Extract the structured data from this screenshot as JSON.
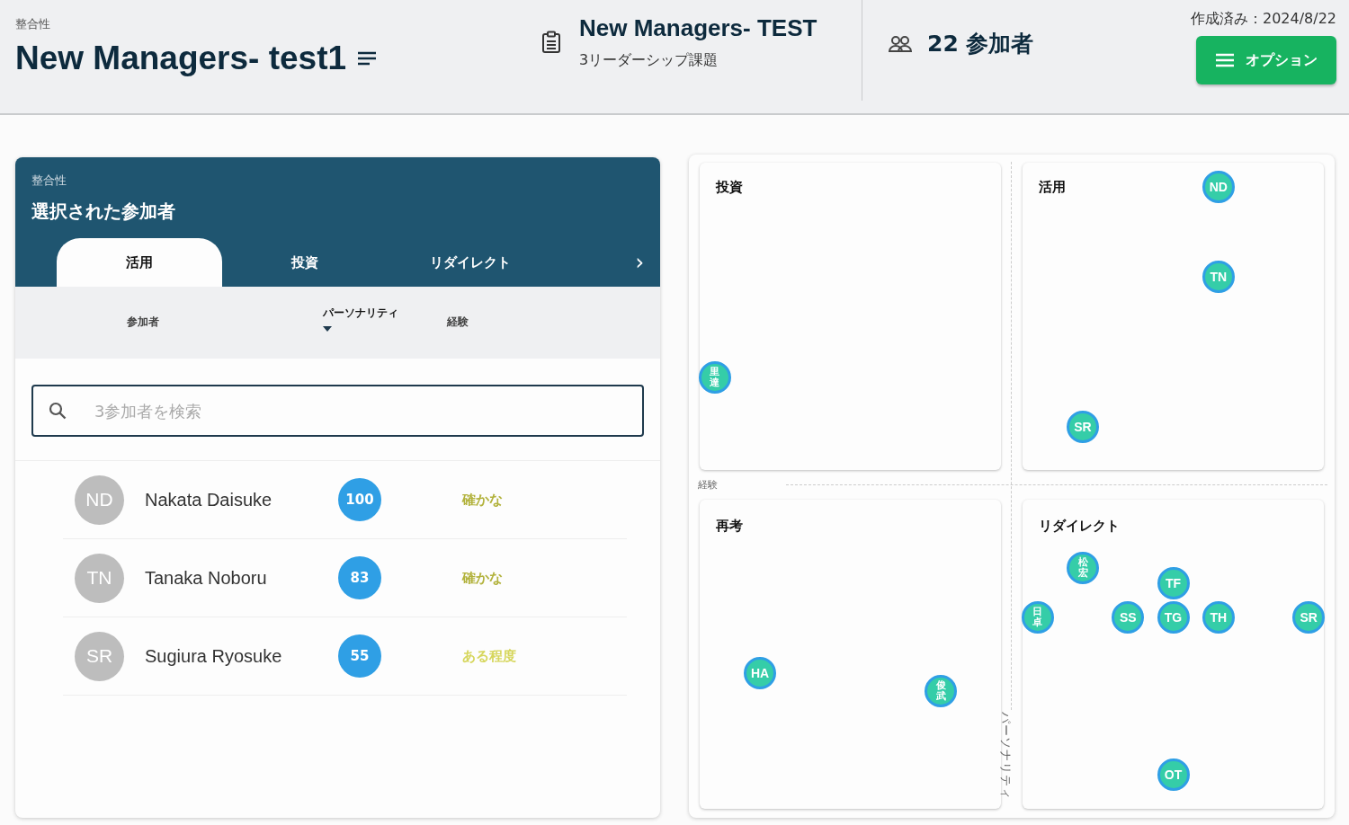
{
  "header": {
    "overline": "整合性",
    "title": "New Managers- test1",
    "assessment": {
      "title": "New Managers- TEST",
      "subtitle": "3リーダーシップ課題"
    },
    "participants": "22 参加者",
    "created": "作成済み：2024/8/22",
    "options_button": "オプション"
  },
  "panel": {
    "overline": "整合性",
    "title": "選択された参加者",
    "tabs": [
      {
        "label": "活用",
        "selected": true
      },
      {
        "label": "投資",
        "selected": false
      },
      {
        "label": "リダイレクト",
        "selected": false
      }
    ],
    "next": "›",
    "columns": [
      {
        "label": "参加者",
        "sorted": false
      },
      {
        "label": "パーソナリティ",
        "sorted": true
      },
      {
        "label": "経験",
        "sorted": false
      }
    ],
    "search": {
      "placeholder": "3参加者を検索"
    },
    "rows": [
      {
        "initials": "ND",
        "name": "Nakata Daisuke",
        "score": "100",
        "level": "確かな",
        "color": "#b2b23c"
      },
      {
        "initials": "TN",
        "name": "Tanaka Noboru",
        "score": "83",
        "level": "確かな",
        "color": "#b2b23c"
      },
      {
        "initials": "SR",
        "name": "Sugiura Ryosuke",
        "score": "55",
        "level": "ある程度",
        "color": "#d6d65c"
      }
    ]
  },
  "matrix": {
    "x_axis": "経験",
    "y_axis": "パーソナリティ",
    "quadrants": [
      {
        "title": "投資",
        "dots": [
          {
            "label": "里達",
            "kind": "kanji"
          }
        ]
      },
      {
        "title": "活用",
        "dots": [
          {
            "label": "ND",
            "kind": "latin"
          },
          {
            "label": "TN",
            "kind": "latin"
          },
          {
            "label": "SR",
            "kind": "latin"
          }
        ]
      },
      {
        "title": "再考",
        "dots": [
          {
            "label": "HA",
            "kind": "latin"
          },
          {
            "label": "俊武",
            "kind": "kanji"
          }
        ]
      },
      {
        "title": "リダイレクト",
        "dots": [
          {
            "label": "松宏",
            "kind": "kanji"
          },
          {
            "label": "TF",
            "kind": "latin"
          },
          {
            "label": "日卓",
            "kind": "kanji"
          },
          {
            "label": "SS",
            "kind": "latin"
          },
          {
            "label": "TG",
            "kind": "latin"
          },
          {
            "label": "TH",
            "kind": "latin"
          },
          {
            "label": "SR",
            "kind": "latin"
          },
          {
            "label": "OT",
            "kind": "latin"
          }
        ]
      }
    ]
  }
}
